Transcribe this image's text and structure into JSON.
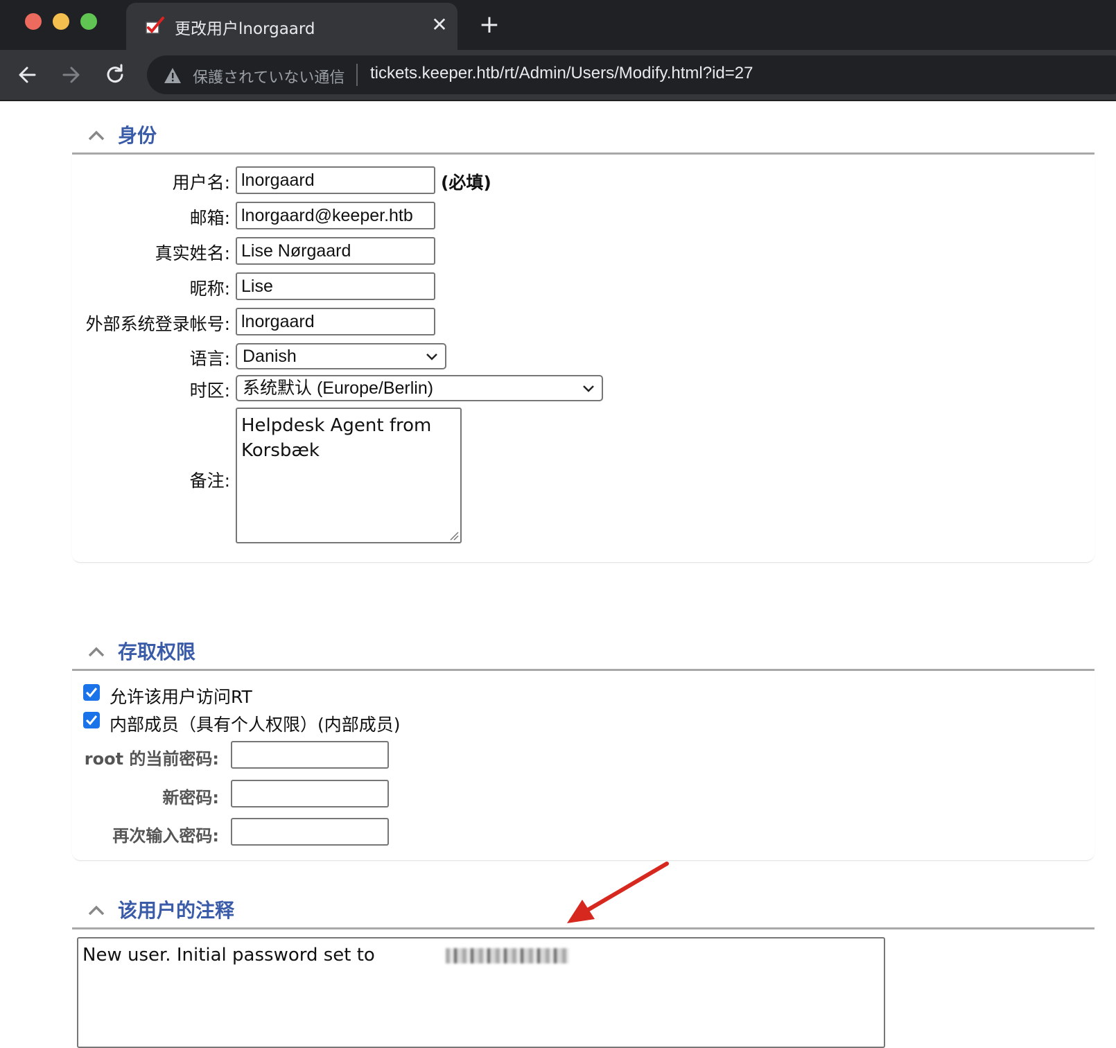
{
  "browser": {
    "tab_title": "更改用户lnorgaard",
    "not_secure_text": "保護されていない通信",
    "url": "tickets.keeper.htb/rt/Admin/Users/Modify.html?id=27",
    "new_tab_glyph": "+",
    "close_tab_glyph": "✕"
  },
  "identity": {
    "section_title": "身份",
    "fields": {
      "username_label": "用户名:",
      "username_value": "lnorgaard",
      "required_note": "(必填)",
      "email_label": "邮箱:",
      "email_value": "lnorgaard@keeper.htb",
      "realname_label": "真实姓名:",
      "realname_value": "Lise Nørgaard",
      "nickname_label": "昵称:",
      "nickname_value": "Lise",
      "external_auth_label": "外部系统登录帐号:",
      "external_auth_value": "lnorgaard",
      "language_label": "语言:",
      "language_value": "Danish",
      "timezone_label": "时区:",
      "timezone_value": "系统默认 (Europe/Berlin)",
      "comments_label": "备注:",
      "comments_value": "Helpdesk Agent from Korsbæk"
    }
  },
  "access": {
    "section_title": "存取权限",
    "allow_rt_label": "允许该用户访问RT",
    "allow_rt_checked": true,
    "privileged_label": "内部成员（具有个人权限）(内部成员)",
    "privileged_checked": true,
    "current_password_label": "root 的当前密码:",
    "new_password_label": "新密码:",
    "retype_password_label": "再次输入密码:"
  },
  "notes": {
    "section_title": "该用户的注释",
    "text": "New user. Initial password set to"
  },
  "colors": {
    "section_title": "#3a5ca8",
    "checkbox": "#1a73e8",
    "annotation_arrow": "#d6281e"
  }
}
